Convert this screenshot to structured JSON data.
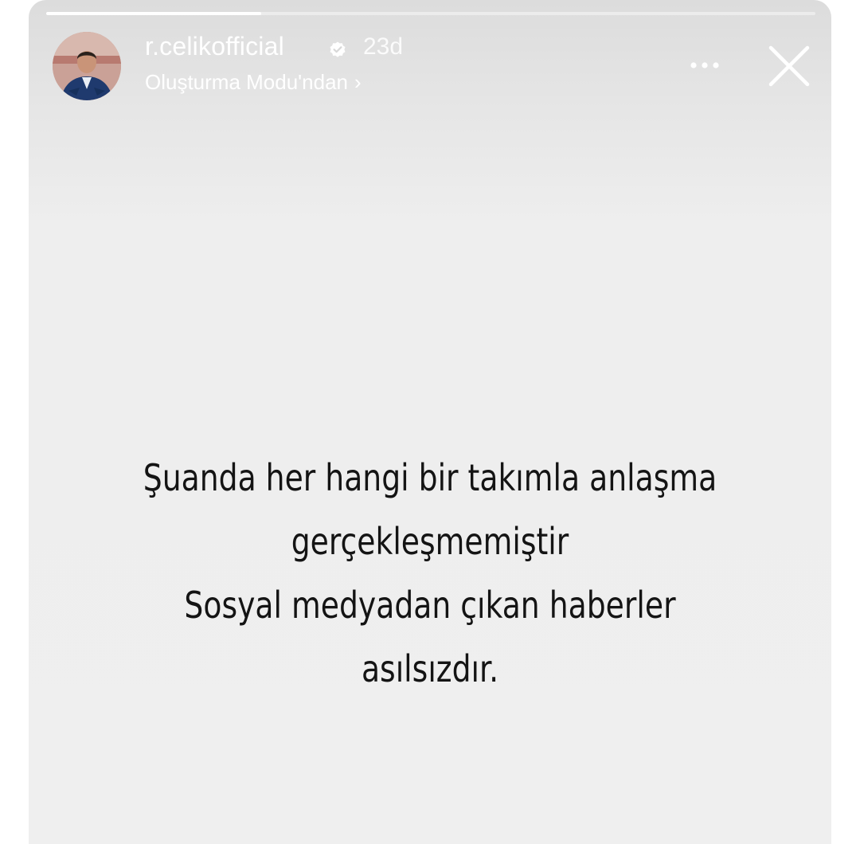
{
  "story": {
    "progress": 0.28,
    "username": "r.celikofficial",
    "verified_icon": "verified-badge-icon",
    "time_ago": "23d",
    "mode_link": "Oluşturma Modu'ndan",
    "mode_link_chevron": "›",
    "more_icon": "more-dots-icon",
    "close_icon": "close-icon",
    "caption_lines": [
      "Şuanda her hangi bir takımla anlaşma",
      "gerçekleşmemiştir",
      "Sosyal medyadan çıkan haberler",
      "asılsızdır."
    ]
  },
  "colors": {
    "background": "#efefef",
    "text": "#141414",
    "overlay_text": "#ffffff"
  }
}
